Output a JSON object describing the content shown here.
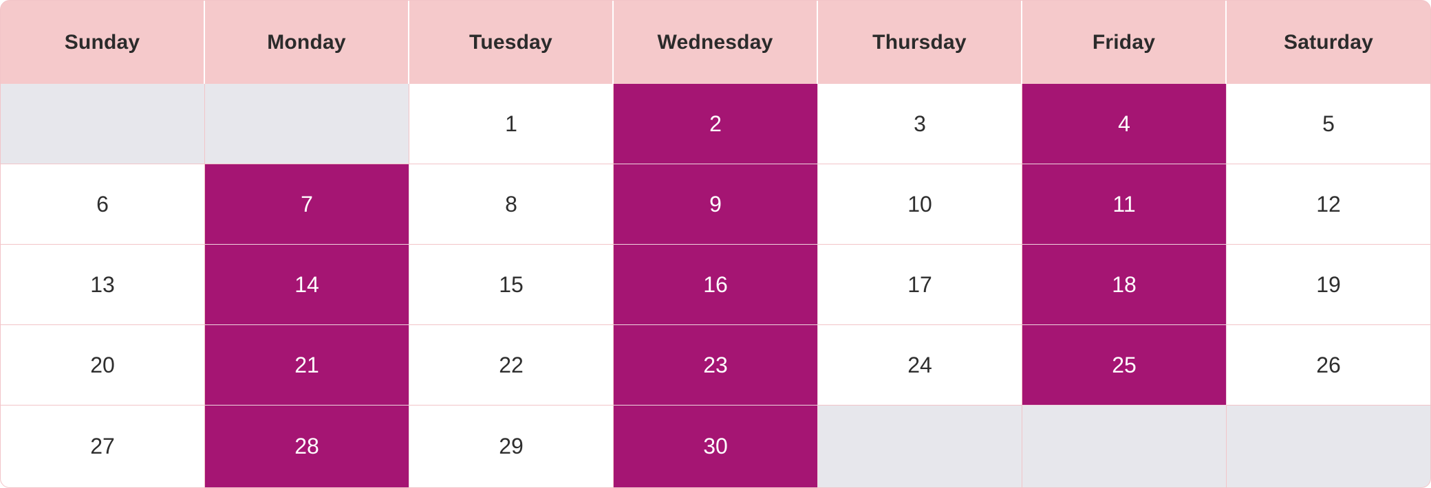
{
  "calendar": {
    "weekdays": [
      "Sunday",
      "Monday",
      "Tuesday",
      "Wednesday",
      "Thursday",
      "Friday",
      "Saturday"
    ],
    "weeks": [
      [
        {
          "label": "",
          "state": "empty"
        },
        {
          "label": "",
          "state": "empty"
        },
        {
          "label": "1",
          "state": "normal"
        },
        {
          "label": "2",
          "state": "highlight"
        },
        {
          "label": "3",
          "state": "normal"
        },
        {
          "label": "4",
          "state": "highlight"
        },
        {
          "label": "5",
          "state": "normal"
        }
      ],
      [
        {
          "label": "6",
          "state": "normal"
        },
        {
          "label": "7",
          "state": "highlight"
        },
        {
          "label": "8",
          "state": "normal"
        },
        {
          "label": "9",
          "state": "highlight"
        },
        {
          "label": "10",
          "state": "normal"
        },
        {
          "label": "11",
          "state": "highlight"
        },
        {
          "label": "12",
          "state": "normal"
        }
      ],
      [
        {
          "label": "13",
          "state": "normal"
        },
        {
          "label": "14",
          "state": "highlight"
        },
        {
          "label": "15",
          "state": "normal"
        },
        {
          "label": "16",
          "state": "highlight"
        },
        {
          "label": "17",
          "state": "normal"
        },
        {
          "label": "18",
          "state": "highlight"
        },
        {
          "label": "19",
          "state": "normal"
        }
      ],
      [
        {
          "label": "20",
          "state": "normal"
        },
        {
          "label": "21",
          "state": "highlight"
        },
        {
          "label": "22",
          "state": "normal"
        },
        {
          "label": "23",
          "state": "highlight"
        },
        {
          "label": "24",
          "state": "normal"
        },
        {
          "label": "25",
          "state": "highlight"
        },
        {
          "label": "26",
          "state": "normal"
        }
      ],
      [
        {
          "label": "27",
          "state": "normal"
        },
        {
          "label": "28",
          "state": "highlight"
        },
        {
          "label": "29",
          "state": "normal"
        },
        {
          "label": "30",
          "state": "highlight"
        },
        {
          "label": "",
          "state": "empty"
        },
        {
          "label": "",
          "state": "empty"
        },
        {
          "label": "",
          "state": "empty"
        }
      ]
    ]
  },
  "colors": {
    "header_bg": "#f5c9cb",
    "highlight_bg": "#a51573",
    "empty_bg": "#e7e7ec",
    "grid_line": "#f2c4c8"
  }
}
